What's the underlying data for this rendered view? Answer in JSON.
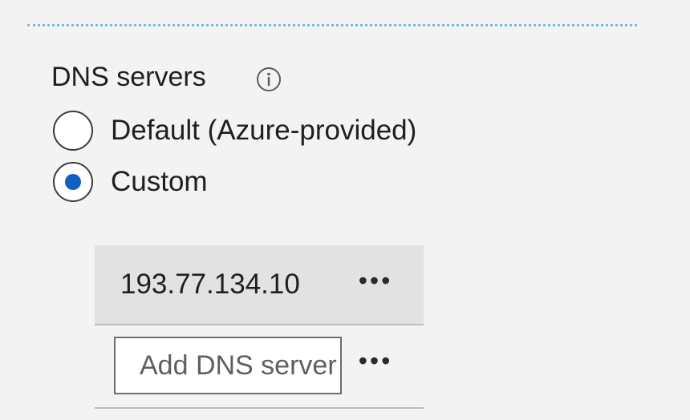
{
  "dns": {
    "label": "DNS servers",
    "info_icon": "info-icon",
    "options": [
      {
        "label": "Default (Azure-provided)",
        "selected": false
      },
      {
        "label": "Custom",
        "selected": true
      }
    ],
    "servers": [
      {
        "value": "193.77.134.10",
        "menu": "•••"
      }
    ],
    "add_field": {
      "placeholder": "Add DNS server",
      "value": "",
      "menu": "•••"
    },
    "accent_color": "#0f5fc3"
  }
}
